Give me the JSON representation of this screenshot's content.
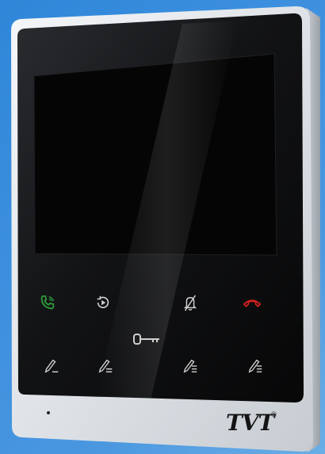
{
  "device": {
    "brand": "TVT",
    "registered_mark": "®"
  },
  "buttons": [
    {
      "name": "answer-call-button",
      "icon": "phone-answer-icon",
      "color": "#2e9a3a"
    },
    {
      "name": "playback-button",
      "icon": "playback-icon",
      "color": "#cfcfcf"
    },
    {
      "name": "mute-button",
      "icon": "bell-mute-icon",
      "color": "#cfcfcf"
    },
    {
      "name": "hang-up-button",
      "icon": "phone-hangup-icon",
      "color": "#d42020"
    },
    {
      "name": "unlock-button",
      "icon": "key-icon",
      "color": "#cfcfcf"
    },
    {
      "name": "edit-button-1",
      "icon": "pencil-line-icon",
      "color": "#cfcfcf"
    },
    {
      "name": "edit-button-2",
      "icon": "pencil-equal-icon",
      "color": "#cfcfcf"
    },
    {
      "name": "edit-button-3",
      "icon": "pencil-list-icon",
      "color": "#cfcfcf"
    },
    {
      "name": "edit-button-4",
      "icon": "pencil-list-icon",
      "color": "#cfcfcf"
    }
  ],
  "colors": {
    "background": "#3c8fde",
    "frame": "#e9ecef",
    "glass": "#111214",
    "screen": "#050505"
  }
}
